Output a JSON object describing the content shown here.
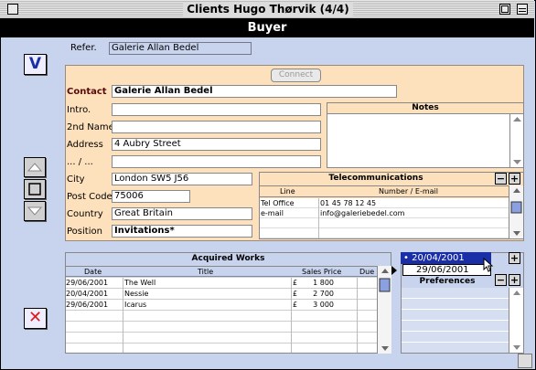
{
  "window": {
    "title": "Clients Hugo Thørvik (4/4)"
  },
  "header": {
    "title": "Buyer"
  },
  "sidebar": {
    "check_label": "V",
    "delete_label": "✕"
  },
  "refer": {
    "label": "Refer.",
    "value": "Galerie Allan Bedel"
  },
  "connect": {
    "label": "Connect"
  },
  "fields": {
    "contact": {
      "label": "Contact",
      "value": "Galerie Allan Bedel"
    },
    "intro": {
      "label": "Intro.",
      "value": ""
    },
    "name2": {
      "label": "2nd Name",
      "value": ""
    },
    "address": {
      "label": "Address",
      "value": "4 Aubry Street"
    },
    "address2": {
      "label": "... / ...",
      "value": ""
    },
    "city": {
      "label": "City",
      "value": "London SW5 J56"
    },
    "postcode": {
      "label": "Post Code",
      "value": "75006"
    },
    "country": {
      "label": "Country",
      "value": "Great Britain"
    },
    "position": {
      "label": "Position",
      "value": "Invitations*"
    }
  },
  "notes": {
    "title": "Notes"
  },
  "telecom": {
    "title": "Telecommunications",
    "headers": [
      "Line",
      "Number / E-mail"
    ],
    "rows": [
      {
        "line": "Tel Office",
        "number": "01 45 78 12 45"
      },
      {
        "line": "e-mail",
        "number": "info@galeriebedel.com"
      }
    ]
  },
  "works": {
    "title": "Acquired Works",
    "headers": {
      "date": "Date",
      "title": "Title",
      "price": "Sales Price",
      "due": "Due"
    },
    "rows": [
      {
        "date": "29/06/2001",
        "title": "The Well",
        "currency": "£",
        "price": "1 800"
      },
      {
        "date": "20/04/2001",
        "title": "Nessie",
        "currency": "£",
        "price": "2 700"
      },
      {
        "date": "29/06/2001",
        "title": "Icarus",
        "currency": "£",
        "price": "3 000"
      }
    ]
  },
  "preferences": {
    "title": "Preferences",
    "date_selected": "20/04/2001",
    "date_option": "29/06/2001"
  },
  "buttons": {
    "minus": "−",
    "plus": "+"
  }
}
